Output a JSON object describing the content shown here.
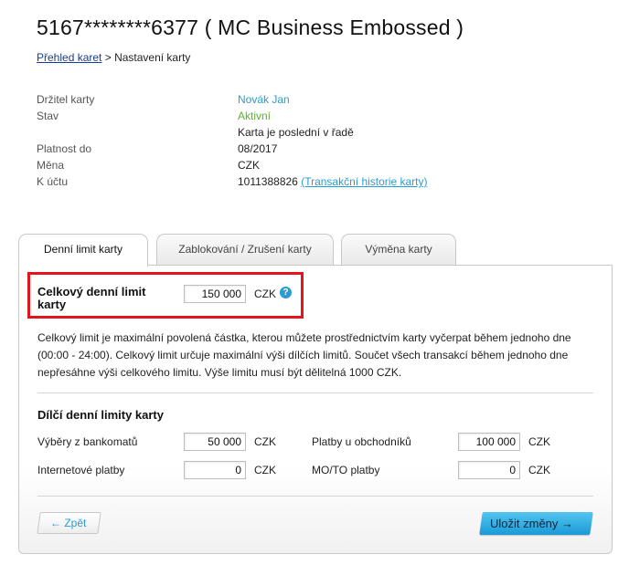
{
  "title": "5167********6377 ( MC Business Embossed )",
  "breadcrumb": {
    "link": "Přehled karet",
    "separator": " > ",
    "current": "Nastavení karty"
  },
  "card_info": {
    "holder_label": "Držitel karty",
    "holder_value": "Novák Jan",
    "status_label": "Stav",
    "status_value": "Aktivní",
    "last_in_line": "Karta je poslední v řadě",
    "validity_label": "Platnost do",
    "validity_value": "08/2017",
    "currency_label": "Měna",
    "currency_value": "CZK",
    "account_label": "K účtu",
    "account_value": "1011388826",
    "history_link": "(Transakční historie karty)"
  },
  "tabs": [
    "Denní limit karty",
    "Zablokování / Zrušení karty",
    "Výměna karty"
  ],
  "limits": {
    "total_label": "Celkový denní limit karty",
    "total_value": "150 000",
    "currency": "CZK",
    "help_icon": "?",
    "description": "Celkový limit je maximální povolená částka, kterou můžete prostřednictvím karty vyčerpat během jednoho dne (00:00 - 24:00). Celkový limit určuje maximální výši dílčích limitů. Součet všech transakcí během jednoho dne nepřesáhne výši celkového limitu. Výše limitu musí být dělitelná 1000 CZK.",
    "sub_title": "Dílčí denní limity karty",
    "atm_label": "Výběry z bankomatů",
    "atm_value": "50 000",
    "merchant_label": "Platby u obchodníků",
    "merchant_value": "100 000",
    "internet_label": "Internetové platby",
    "internet_value": "0",
    "moto_label": "MO/TO platby",
    "moto_value": "0"
  },
  "buttons": {
    "back": "← Zpět",
    "save": "Uložit změny →"
  },
  "colors": {
    "highlight": "#e3141c",
    "accent": "#2b9bd0",
    "active_status": "#5ab030",
    "save_button": "#1b9ad6"
  }
}
